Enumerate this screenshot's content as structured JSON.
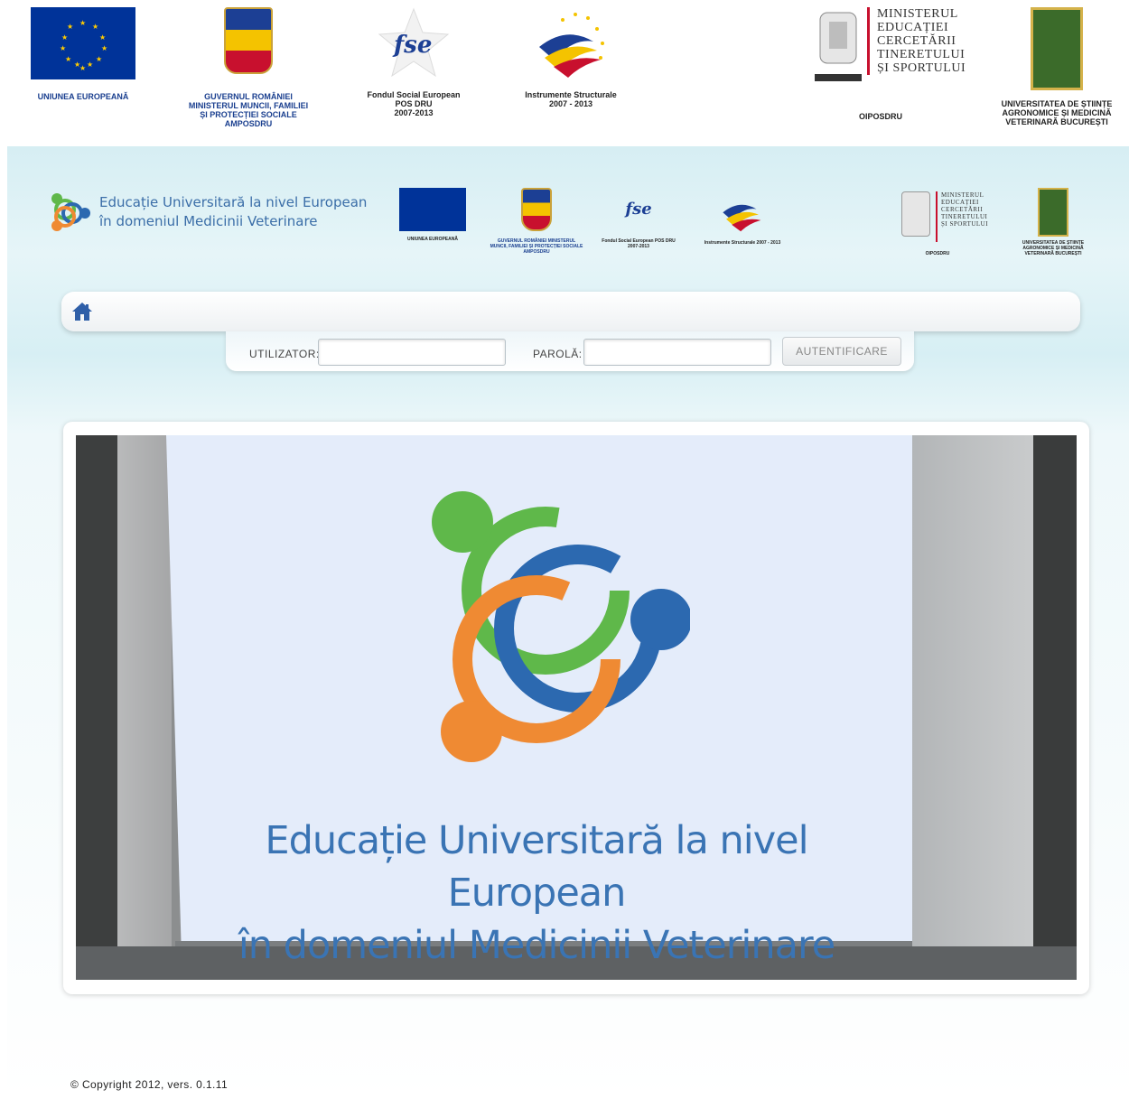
{
  "top_banner": {
    "logos": [
      {
        "icon": "eu-flag-icon",
        "caption": "UNIUNEA EUROPEANĂ"
      },
      {
        "icon": "romania-coat-of-arms-icon",
        "caption_lines": [
          "GUVERNUL ROMÂNIEI",
          "MINISTERUL MUNCII, FAMILIEI",
          "ȘI PROTECȚIEI SOCIALE",
          "AMPOSDRU"
        ]
      },
      {
        "icon": "fse-logo-icon",
        "logo_text": "fse",
        "caption_lines": [
          "Fondul Social European",
          "POS DRU",
          "2007-2013"
        ]
      },
      {
        "icon": "instrumente-structurale-icon",
        "caption_lines": [
          "Instrumente Structurale",
          "2007 - 2013"
        ]
      },
      {
        "icon": "ministry-crest-icon",
        "name_lines": [
          "MINISTERUL",
          "EDUCAȚIEI",
          "CERCETĂRII",
          "TINERETULUI",
          "ȘI SPORTULUI"
        ],
        "caption": "OIPOSDRU"
      },
      {
        "icon": "usamv-crest-icon",
        "caption_lines": [
          "UNIVERSITATEA DE ȘTIINȚE",
          "AGRONOMICE ȘI MEDICINĂ",
          "VETERINARĂ BUCUREȘTI"
        ]
      }
    ]
  },
  "portal": {
    "title_lines": [
      "Educație Universitară la nivel European",
      "în domeniul Medicinii Veterinare"
    ],
    "header_logos": [
      {
        "icon": "eu-flag-icon",
        "caption": "UNIUNEA EUROPEANĂ"
      },
      {
        "icon": "romania-coat-of-arms-icon",
        "caption": "GUVERNUL ROMÂNIEI MINISTERUL MUNCII, FAMILIEI ȘI PROTECȚIEI SOCIALE AMPOSDRU"
      },
      {
        "icon": "fse-logo-icon",
        "caption": "Fondul Social European POS DRU 2007-2013"
      },
      {
        "icon": "instrumente-structurale-icon",
        "caption": "Instrumente Structurale 2007 - 2013"
      },
      {
        "icon": "ministry-crest-icon",
        "caption": "OIPOSDRU"
      },
      {
        "icon": "usamv-crest-icon",
        "caption": "UNIVERSITATEA DE ȘTIINȚE AGRONOMICE ȘI MEDICINĂ VETERINARĂ BUCUREȘTI"
      }
    ],
    "nav": {
      "home_icon": "home-icon"
    },
    "login": {
      "user_label": "UTILIZATOR:",
      "user_value": "",
      "password_label": "PAROLĂ:",
      "password_value": "",
      "submit_label": "AUTENTIFICARE"
    },
    "banner": {
      "title_lines": [
        "Educație Universitară la nivel European",
        "în domeniul Medicinii Veterinare"
      ],
      "logo_icon": "project-rings-logo-icon"
    },
    "footer": {
      "copyright": "© Copyright 2012, vers. 0.1.11"
    }
  },
  "colors": {
    "brand_blue": "#3a74b4",
    "ring_green": "#5fb84a",
    "ring_blue": "#2c69b0",
    "ring_orange": "#ef8a33",
    "eu_blue": "#003399"
  }
}
